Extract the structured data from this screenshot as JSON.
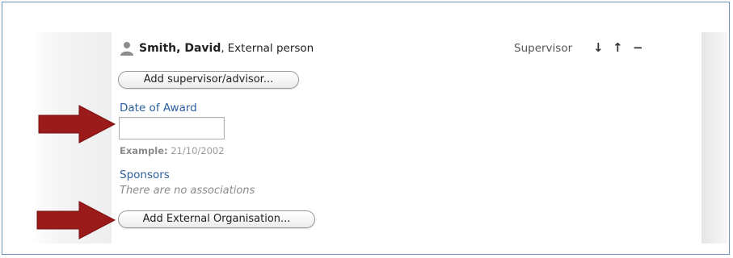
{
  "person": {
    "name": "Smith, David",
    "separator": ",",
    "type": "External person",
    "role": "Supervisor",
    "controls": {
      "down": "↓",
      "up": "↑",
      "remove": "−"
    }
  },
  "buttons": {
    "add_supervisor": "Add supervisor/advisor...",
    "add_external_org": "Add External Organisation..."
  },
  "date_of_award": {
    "label": "Date of Award",
    "value": "",
    "example_label": "Example:",
    "example_value": "21/10/2002"
  },
  "sponsors": {
    "label": "Sponsors",
    "empty_text": "There are no associations"
  },
  "colors": {
    "link": "#2b5f9e",
    "annotation_arrow": "#9b1a1a",
    "frame_border": "#6f95c7"
  },
  "icons": {
    "person": "person-icon",
    "annotation": "red-arrow-icon"
  }
}
